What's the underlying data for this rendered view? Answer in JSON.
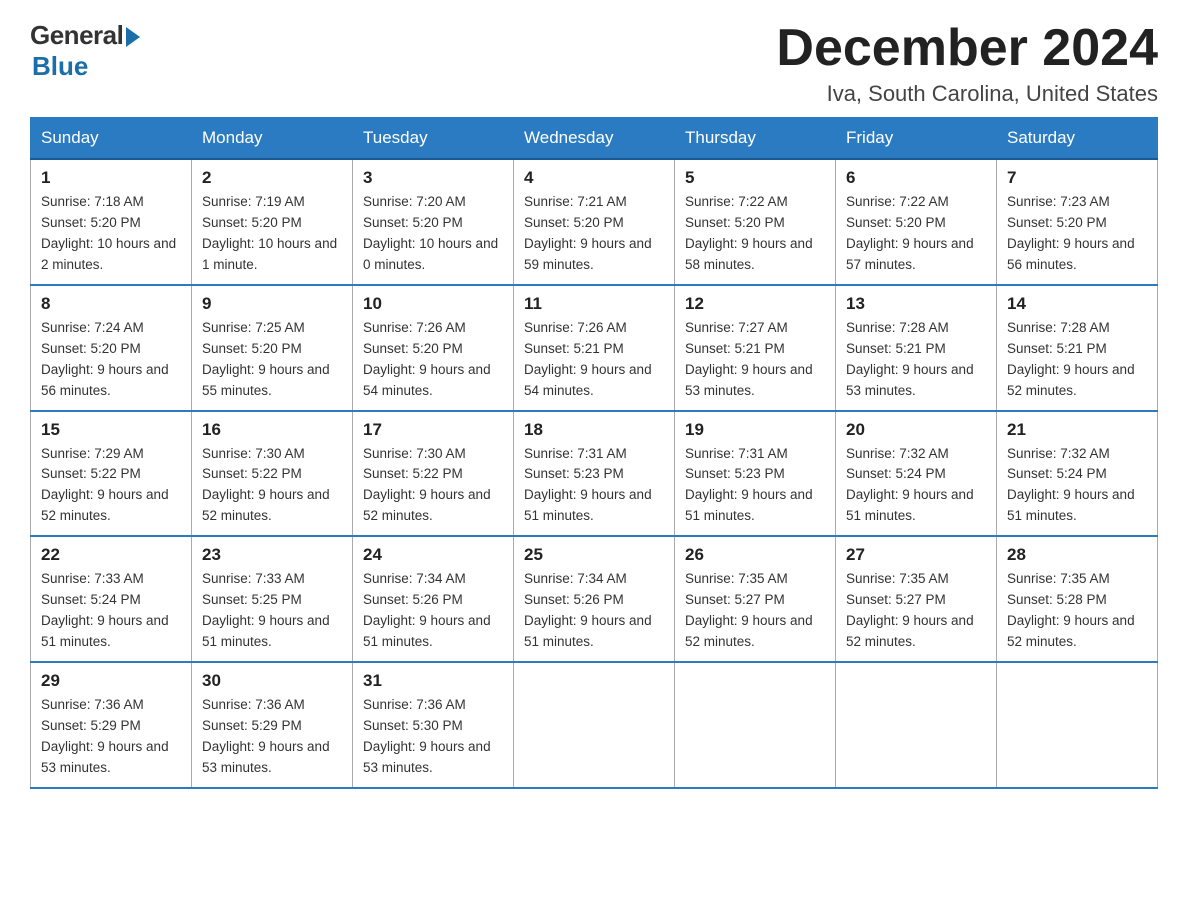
{
  "logo": {
    "general": "General",
    "blue": "Blue"
  },
  "title": "December 2024",
  "location": "Iva, South Carolina, United States",
  "days_of_week": [
    "Sunday",
    "Monday",
    "Tuesday",
    "Wednesday",
    "Thursday",
    "Friday",
    "Saturday"
  ],
  "weeks": [
    [
      {
        "day": "1",
        "sunrise": "7:18 AM",
        "sunset": "5:20 PM",
        "daylight": "10 hours and 2 minutes."
      },
      {
        "day": "2",
        "sunrise": "7:19 AM",
        "sunset": "5:20 PM",
        "daylight": "10 hours and 1 minute."
      },
      {
        "day": "3",
        "sunrise": "7:20 AM",
        "sunset": "5:20 PM",
        "daylight": "10 hours and 0 minutes."
      },
      {
        "day": "4",
        "sunrise": "7:21 AM",
        "sunset": "5:20 PM",
        "daylight": "9 hours and 59 minutes."
      },
      {
        "day": "5",
        "sunrise": "7:22 AM",
        "sunset": "5:20 PM",
        "daylight": "9 hours and 58 minutes."
      },
      {
        "day": "6",
        "sunrise": "7:22 AM",
        "sunset": "5:20 PM",
        "daylight": "9 hours and 57 minutes."
      },
      {
        "day": "7",
        "sunrise": "7:23 AM",
        "sunset": "5:20 PM",
        "daylight": "9 hours and 56 minutes."
      }
    ],
    [
      {
        "day": "8",
        "sunrise": "7:24 AM",
        "sunset": "5:20 PM",
        "daylight": "9 hours and 56 minutes."
      },
      {
        "day": "9",
        "sunrise": "7:25 AM",
        "sunset": "5:20 PM",
        "daylight": "9 hours and 55 minutes."
      },
      {
        "day": "10",
        "sunrise": "7:26 AM",
        "sunset": "5:20 PM",
        "daylight": "9 hours and 54 minutes."
      },
      {
        "day": "11",
        "sunrise": "7:26 AM",
        "sunset": "5:21 PM",
        "daylight": "9 hours and 54 minutes."
      },
      {
        "day": "12",
        "sunrise": "7:27 AM",
        "sunset": "5:21 PM",
        "daylight": "9 hours and 53 minutes."
      },
      {
        "day": "13",
        "sunrise": "7:28 AM",
        "sunset": "5:21 PM",
        "daylight": "9 hours and 53 minutes."
      },
      {
        "day": "14",
        "sunrise": "7:28 AM",
        "sunset": "5:21 PM",
        "daylight": "9 hours and 52 minutes."
      }
    ],
    [
      {
        "day": "15",
        "sunrise": "7:29 AM",
        "sunset": "5:22 PM",
        "daylight": "9 hours and 52 minutes."
      },
      {
        "day": "16",
        "sunrise": "7:30 AM",
        "sunset": "5:22 PM",
        "daylight": "9 hours and 52 minutes."
      },
      {
        "day": "17",
        "sunrise": "7:30 AM",
        "sunset": "5:22 PM",
        "daylight": "9 hours and 52 minutes."
      },
      {
        "day": "18",
        "sunrise": "7:31 AM",
        "sunset": "5:23 PM",
        "daylight": "9 hours and 51 minutes."
      },
      {
        "day": "19",
        "sunrise": "7:31 AM",
        "sunset": "5:23 PM",
        "daylight": "9 hours and 51 minutes."
      },
      {
        "day": "20",
        "sunrise": "7:32 AM",
        "sunset": "5:24 PM",
        "daylight": "9 hours and 51 minutes."
      },
      {
        "day": "21",
        "sunrise": "7:32 AM",
        "sunset": "5:24 PM",
        "daylight": "9 hours and 51 minutes."
      }
    ],
    [
      {
        "day": "22",
        "sunrise": "7:33 AM",
        "sunset": "5:24 PM",
        "daylight": "9 hours and 51 minutes."
      },
      {
        "day": "23",
        "sunrise": "7:33 AM",
        "sunset": "5:25 PM",
        "daylight": "9 hours and 51 minutes."
      },
      {
        "day": "24",
        "sunrise": "7:34 AM",
        "sunset": "5:26 PM",
        "daylight": "9 hours and 51 minutes."
      },
      {
        "day": "25",
        "sunrise": "7:34 AM",
        "sunset": "5:26 PM",
        "daylight": "9 hours and 51 minutes."
      },
      {
        "day": "26",
        "sunrise": "7:35 AM",
        "sunset": "5:27 PM",
        "daylight": "9 hours and 52 minutes."
      },
      {
        "day": "27",
        "sunrise": "7:35 AM",
        "sunset": "5:27 PM",
        "daylight": "9 hours and 52 minutes."
      },
      {
        "day": "28",
        "sunrise": "7:35 AM",
        "sunset": "5:28 PM",
        "daylight": "9 hours and 52 minutes."
      }
    ],
    [
      {
        "day": "29",
        "sunrise": "7:36 AM",
        "sunset": "5:29 PM",
        "daylight": "9 hours and 53 minutes."
      },
      {
        "day": "30",
        "sunrise": "7:36 AM",
        "sunset": "5:29 PM",
        "daylight": "9 hours and 53 minutes."
      },
      {
        "day": "31",
        "sunrise": "7:36 AM",
        "sunset": "5:30 PM",
        "daylight": "9 hours and 53 minutes."
      },
      null,
      null,
      null,
      null
    ]
  ]
}
